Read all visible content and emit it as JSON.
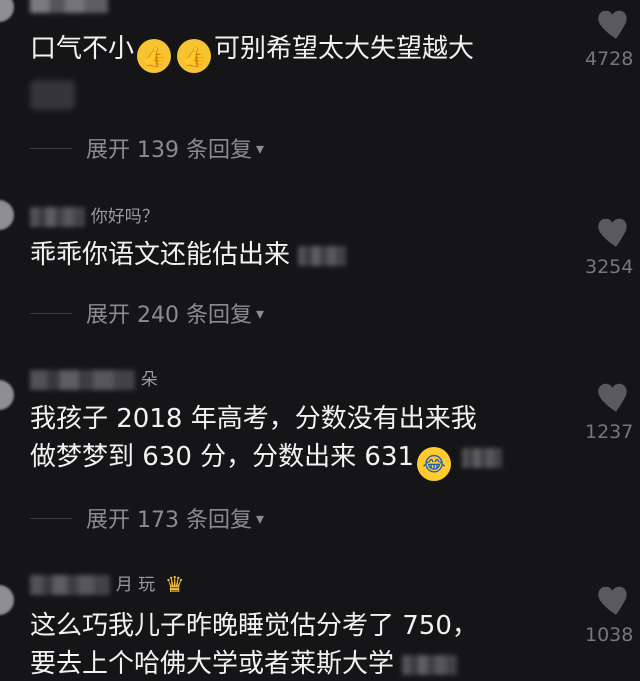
{
  "comments": [
    {
      "username": "",
      "text": "口气不小",
      "text_after": "可别希望太大失望越大",
      "likes": "4728",
      "replies": "展开 139 条回复",
      "replies_caret": "▾"
    },
    {
      "username": "",
      "username_visible": "你好吗？",
      "text": "乖乖你语文还能估出来",
      "likes": "3254",
      "replies": "展开 240 条回复",
      "replies_caret": "▾"
    },
    {
      "username_visible": "朵",
      "text_line1": "我孩子 2018 年高考，分数没有出来我",
      "text_line2": "做梦梦到 630 分，分数出来 631",
      "likes": "1237",
      "replies": "展开 173 条回复",
      "replies_caret": "▾"
    },
    {
      "username_visible": "月 玩",
      "text_line1": "这么巧我儿子昨晚睡觉估分考了 750，",
      "text_line2": "要去上个哈佛大学或者莱斯大学",
      "likes": "1038"
    }
  ],
  "icons": {
    "thumbs_up": "👍",
    "laugh_cry": "😂",
    "crown": "♛",
    "heart": "heart-icon"
  },
  "colors": {
    "background": "#151517",
    "text": "#f2f2f2",
    "muted": "#8c8c90",
    "heart": "#5a5a5e"
  }
}
